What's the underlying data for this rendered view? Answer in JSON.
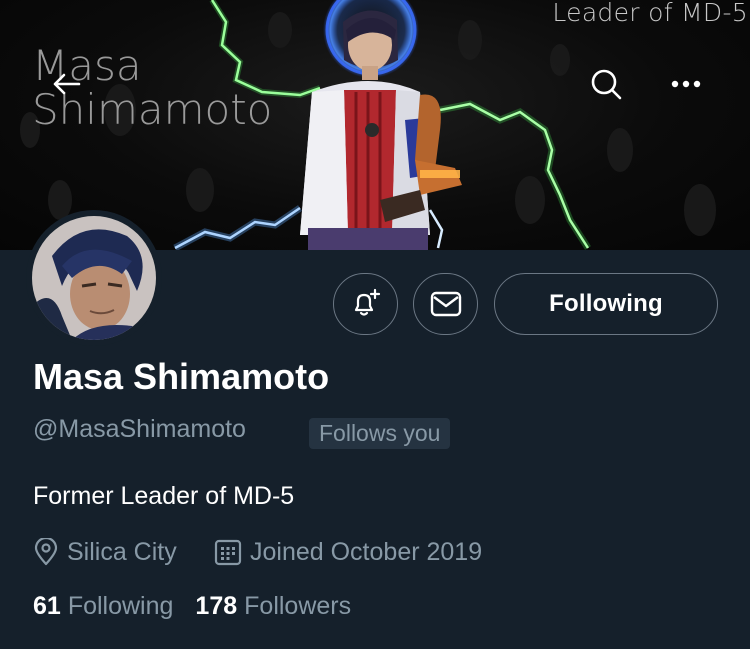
{
  "banner": {
    "caption": "Leader of MD-5",
    "title": "Masa Shimamoto"
  },
  "icons": {
    "back": "arrow-left-icon",
    "search": "search-icon",
    "more": "more-horizontal-icon",
    "notify": "bell-plus-icon",
    "message": "envelope-icon",
    "location": "location-pin-icon",
    "calendar": "calendar-icon"
  },
  "actions": {
    "following_label": "Following"
  },
  "profile": {
    "display_name": "Masa Shimamoto",
    "handle": "@MasaShimamoto",
    "follows_you": "Follows you",
    "bio": "Former Leader of MD-5",
    "location": "Silica City",
    "joined": "Joined October 2019"
  },
  "stats": {
    "following_count": "61",
    "following_label": "Following",
    "followers_count": "178",
    "followers_label": "Followers"
  },
  "colors": {
    "background": "#15202b",
    "secondary_text": "#8899a6",
    "border": "#6b7784",
    "badge_bg": "#253341",
    "lightning_blue": "#5fa8ff",
    "lightning_green": "#4cff5a"
  }
}
